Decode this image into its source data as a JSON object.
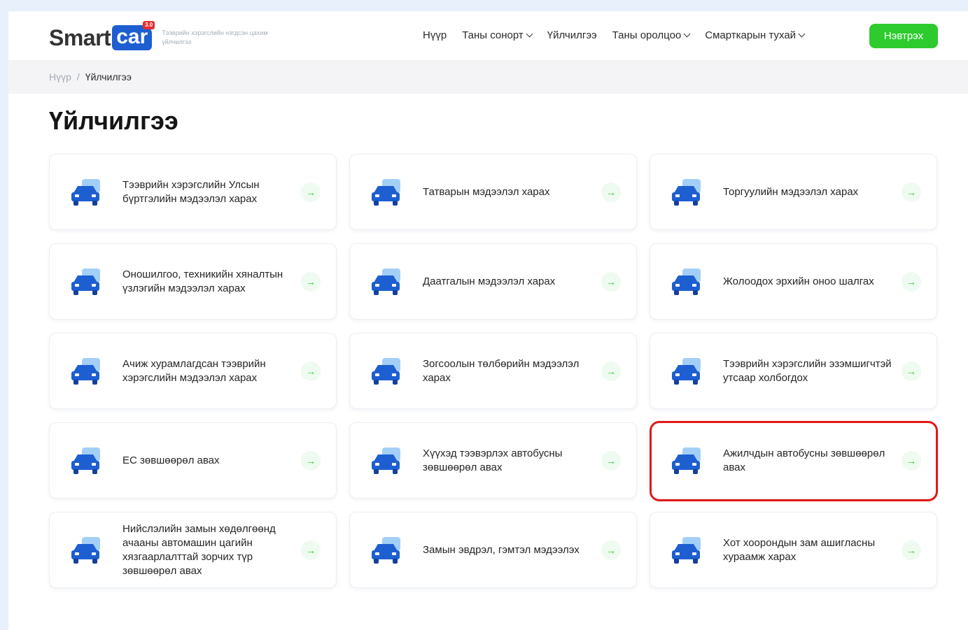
{
  "logo": {
    "word": "Smart",
    "car": "car",
    "badge": "3.0",
    "tagline": "Тээврийн хэрэгслийн нэгдсэн цахим үйлчилгээ"
  },
  "nav": {
    "items": [
      "Нүүр",
      "Таны сонорт",
      "Үйлчилгээ",
      "Таны оролцоо",
      "Смарткарын тухай"
    ],
    "login": "Нэвтрэх"
  },
  "breadcrumb": {
    "home": "Нүүр",
    "separator": "/",
    "current": "Үйлчилгээ"
  },
  "title": "Үйлчилгээ",
  "arrow_glyph": "→",
  "cards": [
    {
      "label": "Тээврийн хэрэгслийн Улсын бүртгэлийн мэдээлэл харах",
      "icon": "car-registration-icon"
    },
    {
      "label": "Татварын мэдээлэл харах",
      "icon": "tax-car-icon"
    },
    {
      "label": "Торгуулийн мэдээлэл харах",
      "icon": "fine-car-icon"
    },
    {
      "label": "Оношилгоо, техникийн хяналтын үзлэгийн мэдээлэл харах",
      "icon": "diagnostics-car-icon"
    },
    {
      "label": "Даатгалын мэдээлэл харах",
      "icon": "insurance-umbrella-icon"
    },
    {
      "label": "Жолоодох эрхийн оноо шалгах",
      "icon": "driver-points-icon"
    },
    {
      "label": "Ачиж хурамлагдсан тээврийн хэрэгслийн мэдээлэл харах",
      "icon": "impounded-car-icon"
    },
    {
      "label": "Зогсоолын төлбөрийн мэдээлэл харах",
      "icon": "parking-icon"
    },
    {
      "label": "Тээврийн хэрэгслийн эзэмшигчтэй утсаар холбогдох",
      "icon": "owner-contact-icon"
    },
    {
      "label": "ЕС зөвшөөрөл авах",
      "icon": "ec-permit-icon"
    },
    {
      "label": "Хүүхэд тээвэрлэх автобусны зөвшөөрөл авах",
      "icon": "child-bus-icon"
    },
    {
      "label": "Ажилчдын автобусны зөвшөөрөл авах",
      "icon": "worker-bus-icon"
    },
    {
      "label": "Нийслэлийн замын хөдөлгөөнд ачааны автомашин цагийн хязгаарлалттай зорчих түр зөвшөөрөл авах",
      "icon": "truck-clock-icon"
    },
    {
      "label": "Замын эвдрэл, гэмтэл мэдээлэх",
      "icon": "road-damage-icon"
    },
    {
      "label": "Хот хоорондын зам ашигласны хураамж харах",
      "icon": "toll-road-icon"
    }
  ],
  "colors": {
    "accent": "#1d5fd1",
    "green": "#2ecb2e",
    "highlight": "#e01818"
  }
}
